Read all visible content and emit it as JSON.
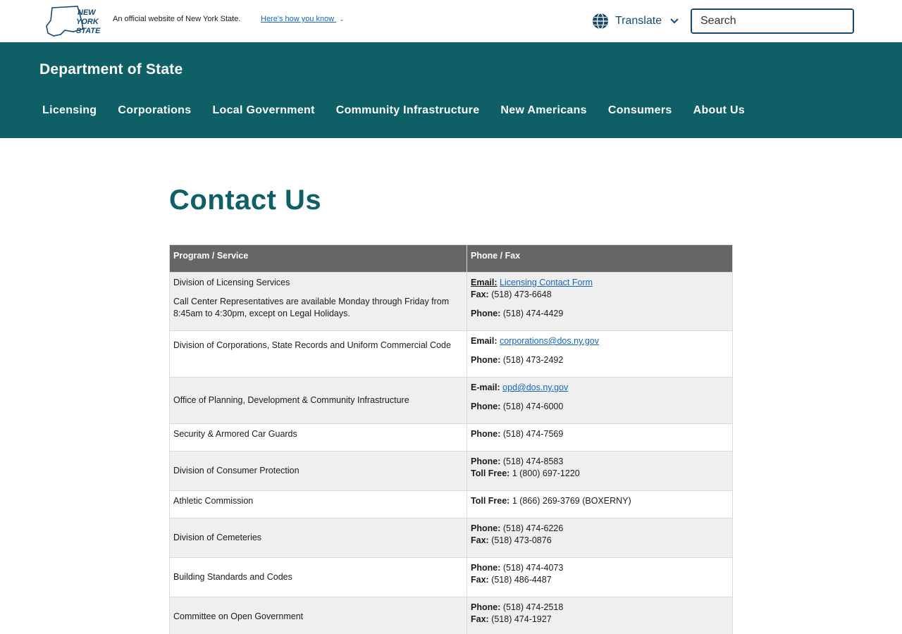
{
  "header": {
    "logo_alt": "New York State",
    "official_text": "An official website of New York State.",
    "how_you_know": "Here's how you know",
    "translate_label": "Translate",
    "search_placeholder": "Search"
  },
  "agency": {
    "title": "Department of State",
    "nav": [
      "Licensing",
      "Corporations",
      "Local Government",
      "Community Infrastructure",
      "New Americans",
      "Consumers",
      "About Us"
    ]
  },
  "page": {
    "title": "Contact Us"
  },
  "table": {
    "headers": [
      "Program / Service",
      "Phone / Fax"
    ],
    "rows": [
      {
        "program": "Division of Licensing Services",
        "program_note": "Call Center Representatives are available Monday through Friday from 8:45am to 4:30pm, except on Legal Holidays.",
        "email_label": "Email:",
        "email_link": "Licensing Contact Form",
        "fax_label": "Fax:",
        "fax": "(518) 473-6648",
        "phone_label": "Phone:",
        "phone": "(518) 474-4429"
      },
      {
        "program": "Division of Corporations, State Records and Uniform Commercial Code",
        "email_label": "Email:",
        "email_link": "corporations@dos.ny.gov",
        "phone_label": "Phone:",
        "phone": "(518) 473-2492"
      },
      {
        "program": "Office of Planning, Development & Community Infrastructure",
        "email_label": "E-mail:",
        "email_link": "opd@dos.ny.gov",
        "phone_label": "Phone:",
        "phone": "(518) 474-6000"
      },
      {
        "program": "Security & Armored Car Guards",
        "phone_label": "Phone:",
        "phone": "(518) 474-7569"
      },
      {
        "program": "Division of Consumer Protection",
        "phone_label": "Phone:",
        "phone": "(518) 474-8583",
        "tollfree_label": "Toll Free:",
        "tollfree": "1 (800) 697-1220"
      },
      {
        "program": "Athletic Commission",
        "tollfree_label": "Toll Free:",
        "tollfree": "1 (866) 269-3769 (BOXERNY)"
      },
      {
        "program": "Division of Cemeteries",
        "phone_label": "Phone:",
        "phone": "(518) 474-6226",
        "fax_label": "Fax:",
        "fax": "(518) 473-0876"
      },
      {
        "program": "Building Standards and Codes",
        "phone_label": "Phone:",
        "phone": "(518) 474-4073",
        "fax_label": "Fax:",
        "fax": "(518) 486-4487"
      },
      {
        "program": "Committee on Open Government",
        "phone_label": "Phone:",
        "phone": "(518) 474-2518",
        "fax_label": "Fax:",
        "fax": "(518) 474-1927"
      }
    ]
  },
  "colors": {
    "agency_bg": "#0e5f66",
    "title_color": "#0e5f66",
    "link": "#1565c0",
    "table_header_bg": "#666666",
    "row_alt_bg": "#efefef",
    "search_border": "#154973"
  },
  "icons": {
    "logo": "new-york-state-logo",
    "how_you_know_chevron": "chevron-down-icon",
    "translate": "globe-icon",
    "translate_chevron": "chevron-down-icon",
    "search": "search-icon"
  }
}
